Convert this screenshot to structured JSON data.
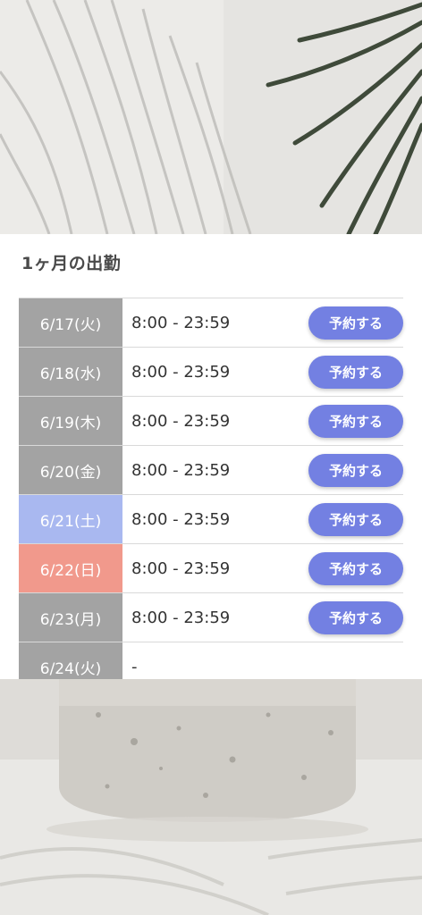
{
  "section": {
    "title": "1ヶ月の出勤"
  },
  "schedule": [
    {
      "date": "6/17(火)",
      "day_type": "weekday",
      "hours": "8:00 - 23:59",
      "button": "予約する"
    },
    {
      "date": "6/18(水)",
      "day_type": "weekday",
      "hours": "8:00 - 23:59",
      "button": "予約する"
    },
    {
      "date": "6/19(木)",
      "day_type": "weekday",
      "hours": "8:00 - 23:59",
      "button": "予約する"
    },
    {
      "date": "6/20(金)",
      "day_type": "weekday",
      "hours": "8:00 - 23:59",
      "button": "予約する"
    },
    {
      "date": "6/21(土)",
      "day_type": "saturday",
      "hours": "8:00 - 23:59",
      "button": "予約する"
    },
    {
      "date": "6/22(日)",
      "day_type": "sunday",
      "hours": "8:00 - 23:59",
      "button": "予約する"
    },
    {
      "date": "6/23(月)",
      "day_type": "weekday",
      "hours": "8:00 - 23:59",
      "button": "予約する"
    },
    {
      "date": "6/24(火)",
      "day_type": "weekday",
      "hours": "-",
      "button": ""
    }
  ],
  "colors": {
    "weekday_bg": "#a3a3a3",
    "saturday_bg": "#a9b8f0",
    "sunday_bg": "#f1998c",
    "button_bg": "#7380e2"
  }
}
